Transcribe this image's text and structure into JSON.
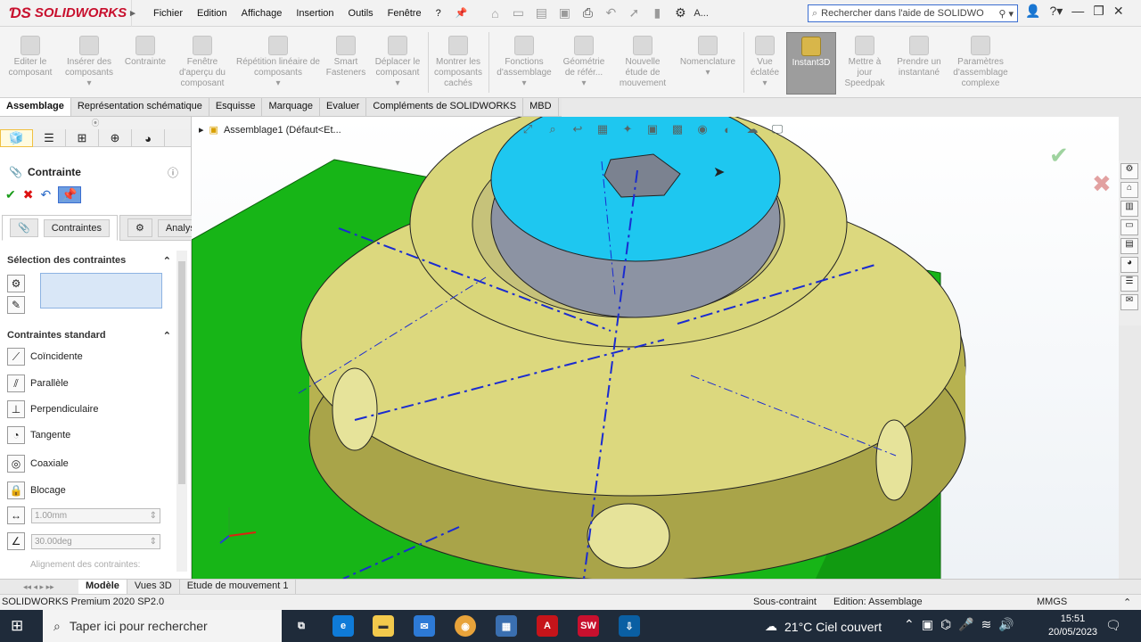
{
  "app": {
    "brand": "SOLIDWORKS"
  },
  "menu": [
    "Fichier",
    "Edition",
    "Affichage",
    "Insertion",
    "Outils",
    "Fenêtre",
    "?"
  ],
  "quick_access_icons": [
    "home-icon",
    "new-file-icon",
    "open-icon",
    "save-icon",
    "print-icon",
    "undo-icon",
    "select-icon",
    "rebuild-icon",
    "options-icon"
  ],
  "quick_access_A": "A...",
  "help_search": {
    "placeholder": "Rechercher dans l'aide de SOLIDWO"
  },
  "commands": [
    {
      "label": "Editer le composant"
    },
    {
      "label": "Insérer des composants"
    },
    {
      "label": "Contrainte"
    },
    {
      "label": "Fenêtre d'aperçu du composant"
    },
    {
      "label": "Répétition linéaire de composants"
    },
    {
      "label": "Smart Fasteners"
    },
    {
      "label": "Déplacer le composant"
    },
    {
      "label": "Montrer les composants cachés"
    },
    {
      "label": "Fonctions d'assemblage"
    },
    {
      "label": "Géométrie de référ..."
    },
    {
      "label": "Nouvelle étude de mouvement"
    },
    {
      "label": "Nomenclature"
    },
    {
      "label": "Vue éclatée"
    },
    {
      "label": "Instant3D"
    },
    {
      "label": "Mettre à jour Speedpak"
    },
    {
      "label": "Prendre un instantané"
    },
    {
      "label": "Paramètres d'assemblage complexe"
    }
  ],
  "tabs": [
    "Assemblage",
    "Représentation schématique",
    "Esquisse",
    "Marquage",
    "Evaluer",
    "Compléments de SOLIDWORKS",
    "MBD"
  ],
  "panel": {
    "title": "Contrainte",
    "subtabs": [
      "Contraintes",
      "Analyse"
    ],
    "selection_header": "Sélection des contraintes",
    "standard_header": "Contraintes standard",
    "mates": [
      "Coïncidente",
      "Parallèle",
      "Perpendiculaire",
      "Tangente",
      "Coaxiale",
      "Blocage"
    ],
    "distance": "1.00mm",
    "angle": "30.00deg",
    "alignment_label": "Alignement des contraintes:"
  },
  "tree": {
    "assembly": "Assemblage1  (Défaut<Et..."
  },
  "bottom_tabs": [
    "Modèle",
    "Vues 3D",
    "Etude de mouvement 1"
  ],
  "status": {
    "product": "SOLIDWORKS Premium 2020 SP2.0",
    "constraint": "Sous-contraint",
    "edition": "Edition: Assemblage",
    "units": "MMGS"
  },
  "taskbar": {
    "search": "Taper ici pour rechercher",
    "weather": "21°C  Ciel couvert",
    "time": "15:51",
    "date": "20/05/2023"
  },
  "colors": {
    "brand": "#c8102e",
    "face_blue": "#1ec7f0",
    "flange": "#d9d67e",
    "base_green": "#17b517",
    "taskbar": "#1f2b3a"
  }
}
